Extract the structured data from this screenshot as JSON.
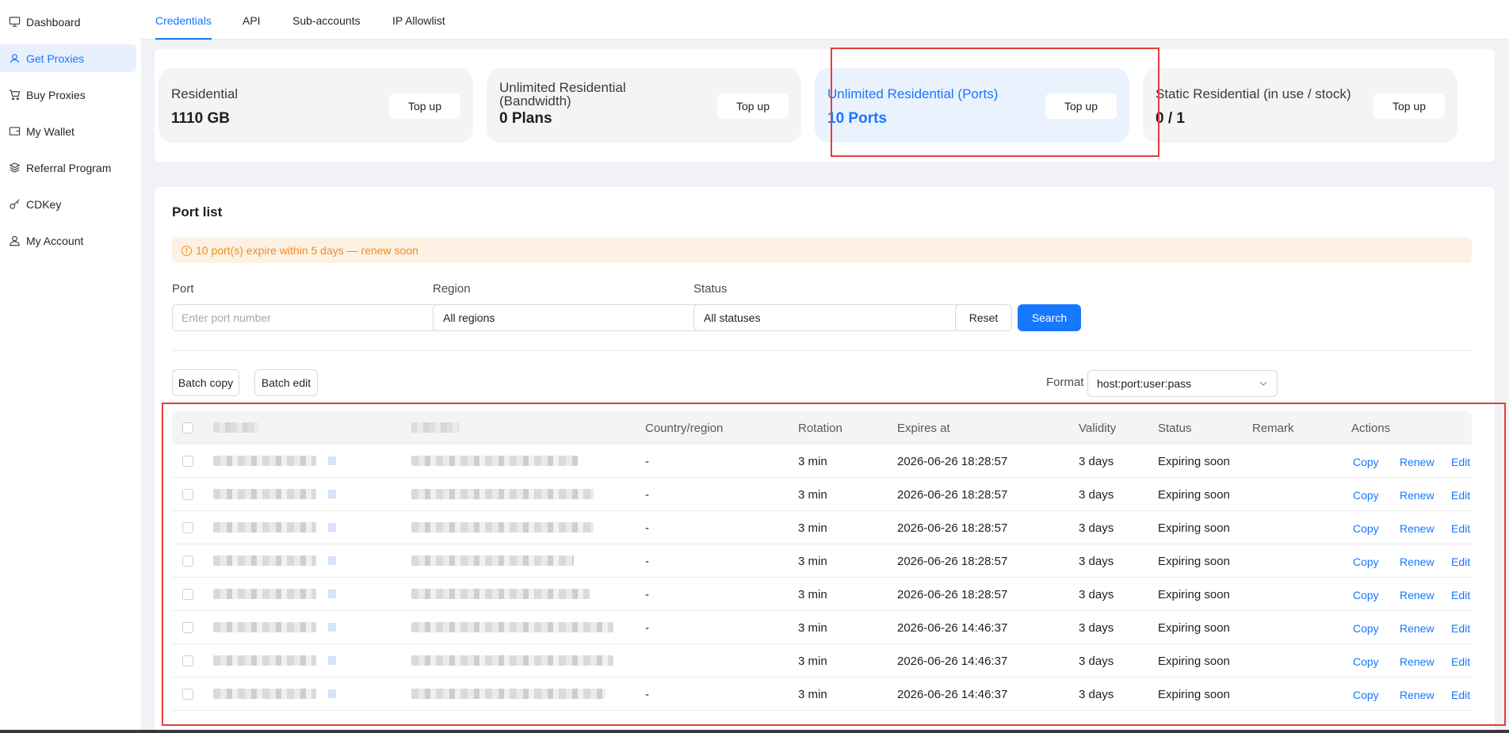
{
  "sidebar": {
    "items": [
      {
        "label": "Dashboard",
        "icon": "dashboard-icon"
      },
      {
        "label": "Get Proxies",
        "icon": "proxy-user-icon",
        "active": true
      },
      {
        "label": "Buy Proxies",
        "icon": "cart-icon"
      },
      {
        "label": "My Wallet",
        "icon": "wallet-icon"
      },
      {
        "label": "Referral Program",
        "icon": "referral-icon"
      },
      {
        "label": "CDKey",
        "icon": "key-icon"
      },
      {
        "label": "My Account",
        "icon": "account-icon"
      }
    ]
  },
  "tabs": [
    "Credentials",
    "API",
    "Sub-accounts",
    "IP Allowlist"
  ],
  "cards": [
    {
      "title": "Residential",
      "value": "1110 GB",
      "button": "Top up"
    },
    {
      "title": "Unlimited Residential (Bandwidth)",
      "value": "0 Plans",
      "button": "Top up"
    },
    {
      "title": "Unlimited Residential (Ports)",
      "value": "10 Ports",
      "button": "Top up"
    },
    {
      "title": "Static Residential (in use / stock)",
      "value": "0 / 1",
      "button": "Top up"
    }
  ],
  "port_list": {
    "title": "Port list",
    "alert": "10 port(s) expire within 5 days — renew soon",
    "filters": {
      "port_label": "Port",
      "port_placeholder": "Enter port number",
      "region_label": "Region",
      "region_value": "All regions",
      "status_label": "Status",
      "status_value": "All statuses",
      "reset": "Reset",
      "search": "Search"
    },
    "batch_copy": "Batch copy",
    "batch_edit": "Batch edit",
    "format_label": "Format",
    "format_value": "host:port:user:pass",
    "columns": [
      "Country/region",
      "Rotation",
      "Expires at",
      "Validity",
      "Status",
      "Remark",
      "Actions"
    ],
    "rows": [
      {
        "country": "-",
        "rotation": "3 min",
        "expires": "2026-06-26 18:28:57",
        "validity": "3 days",
        "status": "Expiring soon"
      },
      {
        "country": "-",
        "rotation": "3 min",
        "expires": "2026-06-26 18:28:57",
        "validity": "3 days",
        "status": "Expiring soon"
      },
      {
        "country": "-",
        "rotation": "3 min",
        "expires": "2026-06-26 18:28:57",
        "validity": "3 days",
        "status": "Expiring soon"
      },
      {
        "country": "-",
        "rotation": "3 min",
        "expires": "2026-06-26 18:28:57",
        "validity": "3 days",
        "status": "Expiring soon"
      },
      {
        "country": "-",
        "rotation": "3 min",
        "expires": "2026-06-26 18:28:57",
        "validity": "3 days",
        "status": "Expiring soon"
      },
      {
        "country": "-",
        "rotation": "3 min",
        "expires": "2026-06-26 14:46:37",
        "validity": "3 days",
        "status": "Expiring soon"
      },
      {
        "country": "",
        "rotation": "3 min",
        "expires": "2026-06-26 14:46:37",
        "validity": "3 days",
        "status": "Expiring soon"
      },
      {
        "country": "-",
        "rotation": "3 min",
        "expires": "2026-06-26 14:46:37",
        "validity": "3 days",
        "status": "Expiring soon"
      }
    ],
    "actions": [
      "Copy",
      "Renew",
      "Edit"
    ]
  },
  "colors": {
    "accent": "#1677ff",
    "warning": "#f08c1a",
    "highlight_border": "#e0403a"
  }
}
